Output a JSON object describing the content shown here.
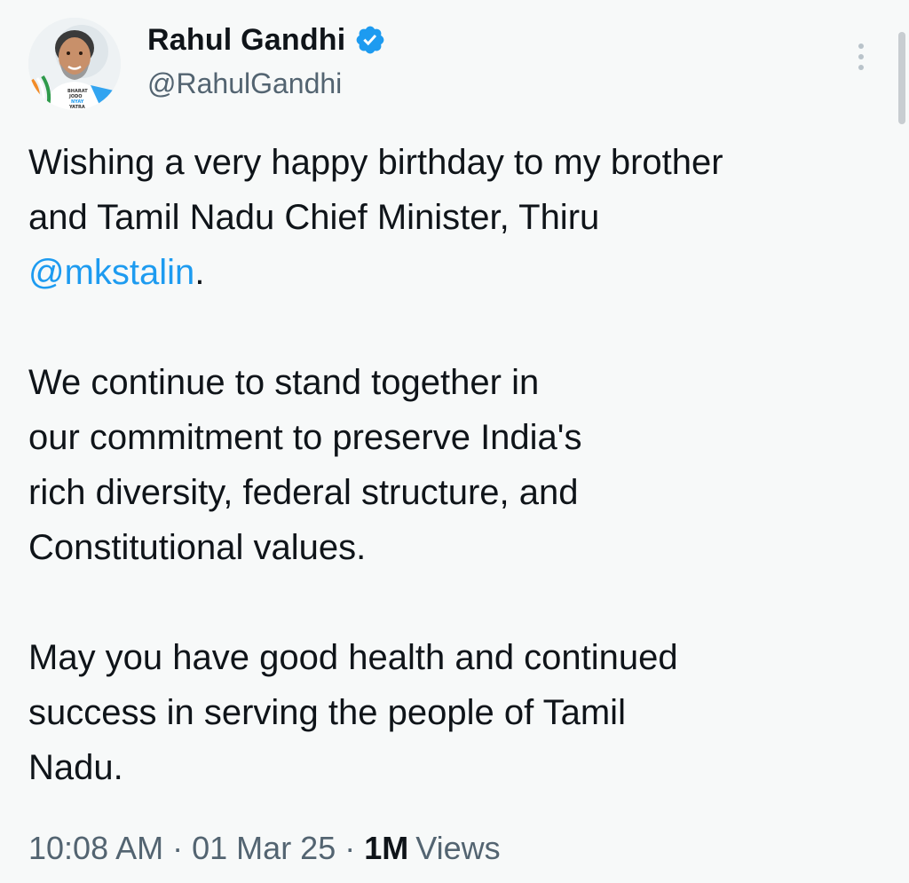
{
  "author": {
    "display_name": "Rahul Gandhi",
    "handle": "@RahulGandhi",
    "verified": true,
    "avatar_icon": "profile-photo",
    "avatar_badge_text": [
      "BHARAT",
      "JODO",
      "NYAY",
      "YATRA"
    ]
  },
  "icons": {
    "verified": "verified-badge-icon",
    "more": "more-options-icon"
  },
  "tweet": {
    "line1": "Wishing a very happy birthday to my brother",
    "line2": "and Tamil Nadu Chief Minister, Thiru",
    "mention": "@mkstalin",
    "mention_suffix": ".",
    "line4": "We continue to stand together in",
    "line5": "our commitment to preserve India's",
    "line6": "rich diversity, federal structure, and",
    "line7": "Constitutional values.",
    "line8": "May you have good health and continued",
    "line9": "success in serving the people of Tamil",
    "line10": "Nadu."
  },
  "meta": {
    "time": "10:08 AM",
    "separator": "·",
    "date": "01 Mar 25",
    "views_count": "1M",
    "views_label": "Views"
  },
  "colors": {
    "background": "#f7f9f9",
    "text": "#0f1419",
    "secondary": "#536471",
    "accent": "#1d9bf0"
  }
}
